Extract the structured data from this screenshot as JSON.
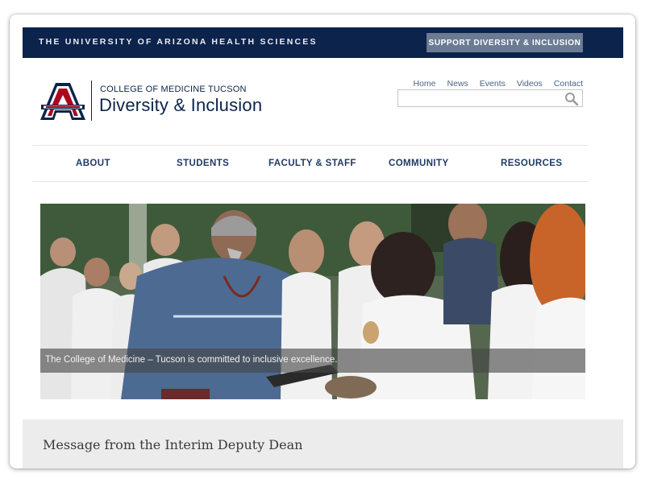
{
  "topbar": {
    "title": "THE UNIVERSITY OF ARIZONA HEALTH SCIENCES",
    "support_button": "SUPPORT DIVERSITY & INCLUSION"
  },
  "header": {
    "college": "COLLEGE OF MEDICINE TUCSON",
    "department": "Diversity & Inclusion",
    "utility_nav": [
      "Home",
      "News",
      "Events",
      "Videos",
      "Contact"
    ],
    "search": {
      "placeholder": "",
      "value": ""
    }
  },
  "main_nav": [
    "ABOUT",
    "STUDENTS",
    "FACULTY & STAFF",
    "COMMUNITY",
    "RESOURCES"
  ],
  "hero": {
    "caption": "The College of Medicine – Tucson is committed to inclusive excellence."
  },
  "section": {
    "heading": "Message from the Interim Deputy Dean"
  },
  "colors": {
    "navy": "#0c234b",
    "red": "#ab0520",
    "support_button_bg": "#6a7b93",
    "nav_text": "#1e3a66"
  }
}
